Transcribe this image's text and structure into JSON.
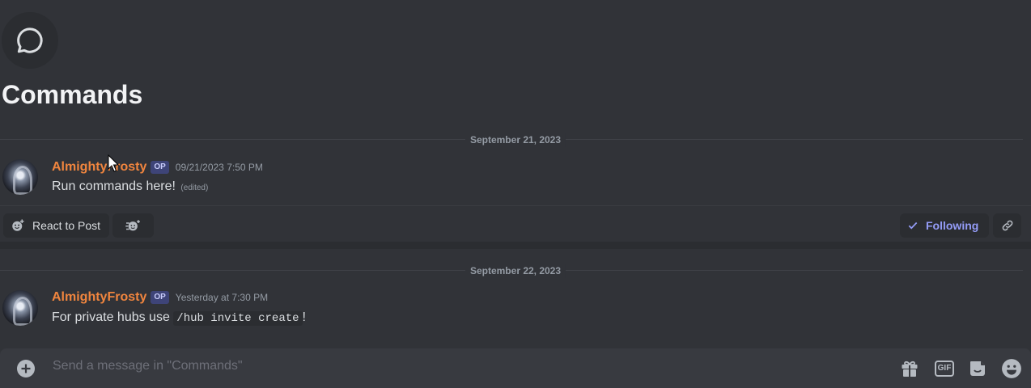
{
  "thread": {
    "title": "Commands",
    "icon": "chat-bubble-icon"
  },
  "messages": [
    {
      "date_divider": "September 21, 2023",
      "author": "AlmightyFrosty",
      "badge": "OP",
      "timestamp": "09/21/2023 7:50 PM",
      "text": "Run commands here!",
      "edited_label": "(edited)"
    },
    {
      "date_divider": "September 22, 2023",
      "author": "AlmightyFrosty",
      "badge": "OP",
      "timestamp": "Yesterday at 7:30 PM",
      "text_before": "For private hubs use ",
      "code": "/hub invite create",
      "text_after": "!"
    }
  ],
  "post_actions": {
    "react_label": "React to Post",
    "following_label": "Following"
  },
  "composer": {
    "placeholder": "Send a message in \"Commands\"",
    "icons": [
      "add-circle-icon",
      "gift-icon",
      "gif-icon",
      "sticker-icon",
      "emoji-icon"
    ]
  },
  "colors": {
    "background": "#313338",
    "username": "#f0853e",
    "accent": "#949cf7",
    "badge": "#5865f2"
  }
}
